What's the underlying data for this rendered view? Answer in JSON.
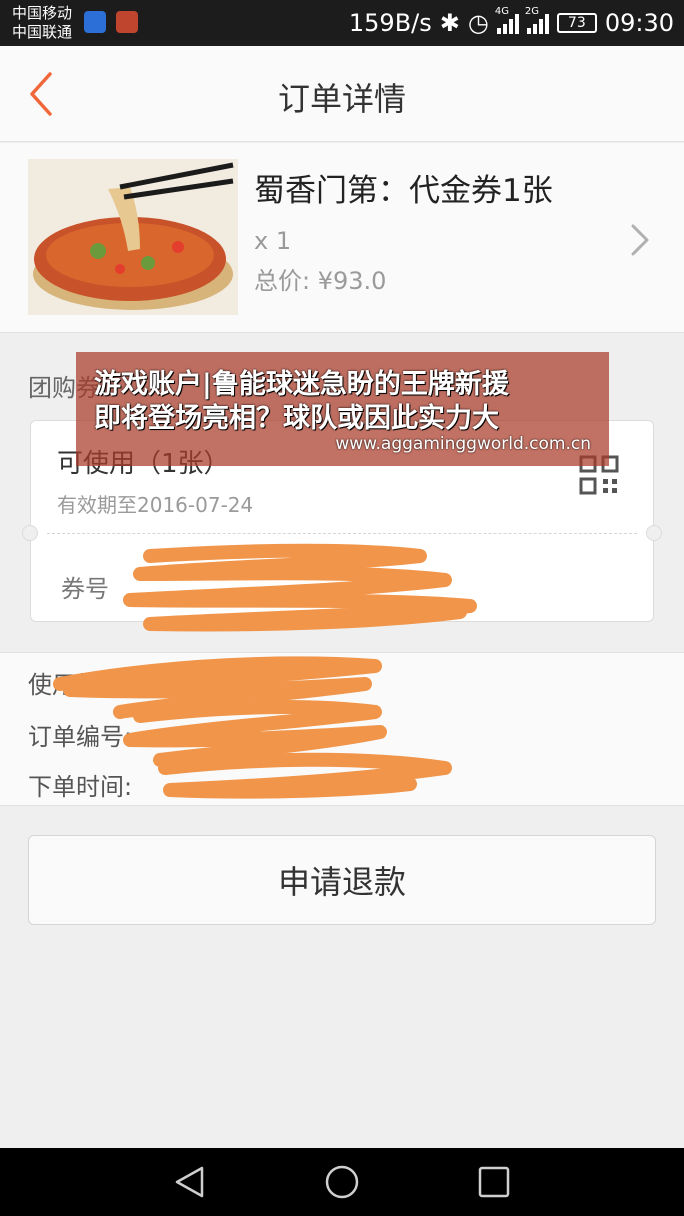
{
  "status_bar": {
    "carrier_1": "中国移动",
    "carrier_2": "中国联通",
    "net_speed": "159B/s",
    "network_1": "4G",
    "network_2": "2G",
    "battery": "73",
    "time": "09:30"
  },
  "header": {
    "title": "订单详情"
  },
  "product": {
    "name": "蜀香门第：代金券1张",
    "quantity": "x 1",
    "total": "总价: ¥93.0"
  },
  "coupon_section": {
    "label": "团购券",
    "status": "可使用（1张）",
    "validity": "有效期至2016-07-24",
    "code_label": "券号"
  },
  "order_info": {
    "usage_label": "使用规则:",
    "order_no_label": "订单编号:",
    "order_time_label": "下单时间:"
  },
  "actions": {
    "refund_label": "申请退款"
  },
  "watermark": {
    "line_1": "游戏账户|鲁能球迷急盼的王牌新援",
    "line_2": "即将登场亮相？球队或因此实力大",
    "url": "www.aggaminggworld.com.cn"
  },
  "colors": {
    "accent": "#f0683a",
    "scribble": "#f0954a",
    "banner": "#aa3c28"
  }
}
